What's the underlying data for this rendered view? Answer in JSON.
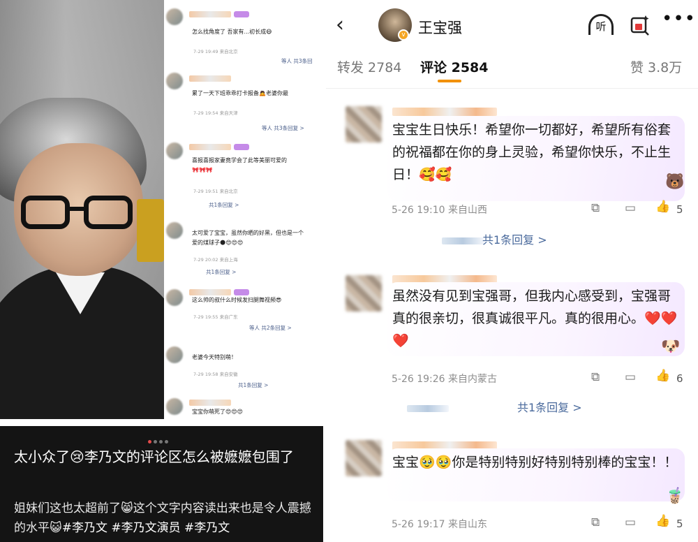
{
  "left": {
    "mini_comments": [
      {
        "text": "怎么找角度了 吾家有...初长成😷",
        "time": "7-29 19:49",
        "location": "来自北京",
        "footer": "等人 共3条回"
      },
      {
        "text": "累了一天下班乖乖打卡报备🙇老婆你最",
        "time": "7-29 19:54",
        "location": "来自天津",
        "footer": "等人 共3条回复 >"
      },
      {
        "text": "喜报喜报家妻竟学会了此等美丽可爱的",
        "time": "7-29 19:51",
        "location": "来自北京",
        "footer": "共1条回复 >"
      },
      {
        "text": "太可爱了宝宝，虽然你晒的好黑，但也是一个",
        "text2": "爱的煤球子🌑😍😍😍",
        "time": "7-29 20:02",
        "location": "来自上海",
        "footer": "共1条回复 >"
      },
      {
        "text": "这么帅的叔什么时候发扫腿舞视频😎",
        "time": "7-29 19:55",
        "location": "来自广东",
        "footer": "等人 共2条回复 >"
      },
      {
        "text": "老婆今天特别萌！",
        "time": "7-29 19:58",
        "location": "来自安徽",
        "footer": "共1条回复 >"
      },
      {
        "text": "宝宝你萌死了😍😍😍",
        "time": "",
        "location": "",
        "footer": ""
      }
    ],
    "caption": {
      "title": "太小众了😢李乃文的评论区怎么被嬷嬷包围了",
      "body_lead": "姐妹们这也太超前了😸这个文字内容读出来也是令人震撼的水平😺",
      "tags": "#李乃文 #李乃文演员 #李乃文"
    }
  },
  "right": {
    "header": {
      "back": "‹",
      "username": "王宝强",
      "verified": "v",
      "listen_icon_text": "听",
      "more": "•••"
    },
    "tabs": {
      "repost": "转发 2784",
      "comment": "评论 2584",
      "like": "赞 3.8万"
    },
    "comments": [
      {
        "text": "宝宝生日快乐！希望你一切都好，希望所有俗套的祝福都在你的身上灵验，希望你快乐，不止生日！🥰🥰",
        "time": "5-26 19:10",
        "location": "来自山西",
        "likes": "5",
        "replies": "共1条回复 >"
      },
      {
        "text": "虽然没有见到宝强哥，但我内心感受到，宝强哥真的很亲切，很真诚很平凡。真的很用心。",
        "hearts": "❤️❤️❤️",
        "time": "5-26 19:26",
        "location": "来自内蒙古",
        "likes": "6",
        "replies": "共1条回复 >"
      },
      {
        "text_lead": "宝宝",
        "emojis": "🥹🥹",
        "text_rest": "你是特别特别好特别特别棒的宝宝！！",
        "time": "5-26 19:17",
        "location": "来自山东",
        "likes": "5"
      }
    ]
  },
  "colors": {
    "accent_orange": "#f29100",
    "link_blue": "#4a6a9c",
    "caption_bg": "#141414"
  }
}
